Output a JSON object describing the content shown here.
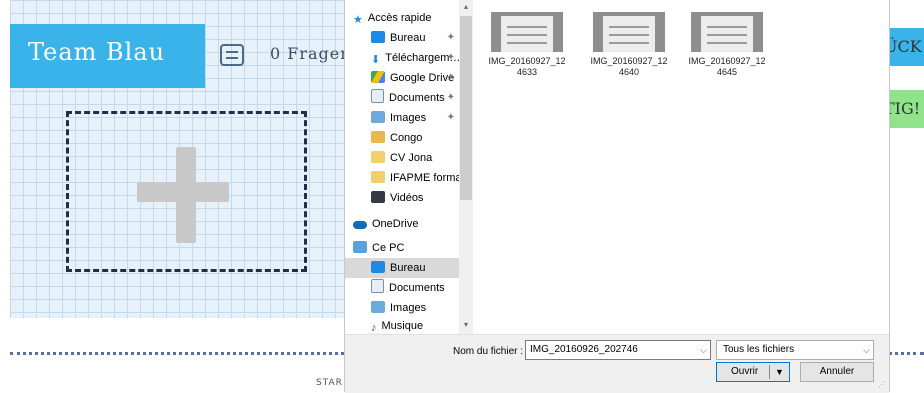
{
  "background_app": {
    "team_title": "Team Blau",
    "fragen_label": "0 Fragen",
    "right_buttons": {
      "zuruck": "ÜCK",
      "fertig": "TIG!"
    },
    "start_label": "STAR"
  },
  "dialog": {
    "nav_items": [
      {
        "label": "Accès rapide",
        "icon": "star-icon",
        "pinned": false
      },
      {
        "label": "Bureau",
        "icon": "desktop-icon",
        "pinned": true
      },
      {
        "label": "Téléchargem…",
        "icon": "download-icon",
        "pinned": true
      },
      {
        "label": "Google Drive",
        "icon": "google-drive-icon",
        "pinned": true
      },
      {
        "label": "Documents",
        "icon": "documents-icon",
        "pinned": true
      },
      {
        "label": "Images",
        "icon": "images-icon",
        "pinned": true
      },
      {
        "label": "Congo",
        "icon": "folder-icon",
        "pinned": false
      },
      {
        "label": "CV Jona",
        "icon": "folder-icon",
        "pinned": false
      },
      {
        "label": "IFAPME formate",
        "icon": "folder-icon",
        "pinned": false
      },
      {
        "label": "Vidéos",
        "icon": "videos-icon",
        "pinned": false
      },
      {
        "label": "OneDrive",
        "icon": "onedrive-icon",
        "pinned": false
      },
      {
        "label": "Ce PC",
        "icon": "computer-icon",
        "pinned": false
      },
      {
        "label": "Bureau",
        "icon": "desktop-icon",
        "pinned": false,
        "selected": true
      },
      {
        "label": "Documents",
        "icon": "documents-icon",
        "pinned": false
      },
      {
        "label": "Images",
        "icon": "images-icon",
        "pinned": false
      },
      {
        "label": "Musique",
        "icon": "music-icon",
        "pinned": false
      }
    ],
    "files": [
      {
        "name_line1": "IMG_20160927_12",
        "name_line2": "4633"
      },
      {
        "name_line1": "IMG_20160927_12",
        "name_line2": "4640"
      },
      {
        "name_line1": "IMG_20160927_12",
        "name_line2": "4645"
      }
    ],
    "filename_label": "Nom du fichier :",
    "filename_value": "IMG_20160926_202746",
    "filetype_value": "Tous les fichiers",
    "open_label": "Ouvrir",
    "cancel_label": "Annuler"
  },
  "colors": {
    "banner_blue": "#3ab3ea",
    "fertig_green": "#8fe38b",
    "selection_gray": "#d9d9d9",
    "accent_blue": "#0078d7"
  }
}
